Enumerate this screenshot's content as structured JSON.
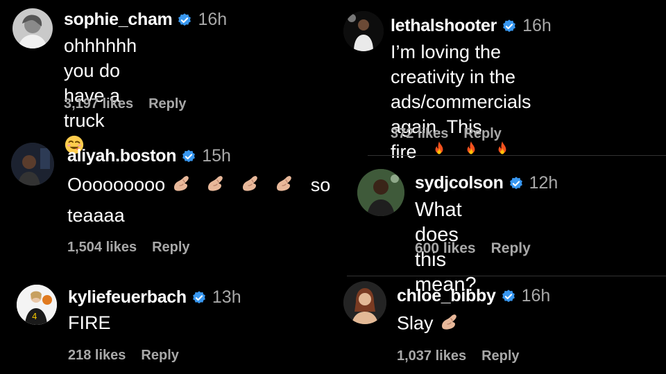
{
  "colors": {
    "background": "#000000",
    "text": "#ffffff",
    "muted": "#a8a8a8",
    "verified": "#3897f0"
  },
  "comments": [
    {
      "username": "sophie_cham",
      "time": "16h",
      "text_lines": [
        "ohhhhhh you do have a truck"
      ],
      "emojis": [
        "smiling-face-with-tongue-wink"
      ],
      "likes": "3,197 likes",
      "reply": "Reply"
    },
    {
      "username": "lethalshooter",
      "time": "16h",
      "text_lines": [
        "I’m loving the creativity in the",
        "ads/commercials again. This",
        "fire"
      ],
      "emojis": [
        "fire",
        "fire",
        "fire"
      ],
      "likes": "372 likes",
      "reply": "Reply"
    },
    {
      "username": "aliyah.boston",
      "time": "15h",
      "text_lines": [
        "Ooooooooo",
        "so",
        "teaaaa"
      ],
      "emojis": [
        "pinched-fingers",
        "pinched-fingers",
        "pinched-fingers",
        "pinched-fingers"
      ],
      "likes": "1,504 likes",
      "reply": "Reply"
    },
    {
      "username": "sydjcolson",
      "time": "12h",
      "text_lines": [
        "What does this mean?"
      ],
      "likes": "600 likes",
      "reply": "Reply"
    },
    {
      "username": "kyliefeuerbach",
      "time": "13h",
      "text_lines": [
        "FIRE"
      ],
      "likes": "218 likes",
      "reply": "Reply"
    },
    {
      "username": "chloe_bibby",
      "time": "16h",
      "text_lines": [
        "Slay"
      ],
      "emojis": [
        "pinched-fingers"
      ],
      "likes": "1,037 likes",
      "reply": "Reply"
    }
  ]
}
